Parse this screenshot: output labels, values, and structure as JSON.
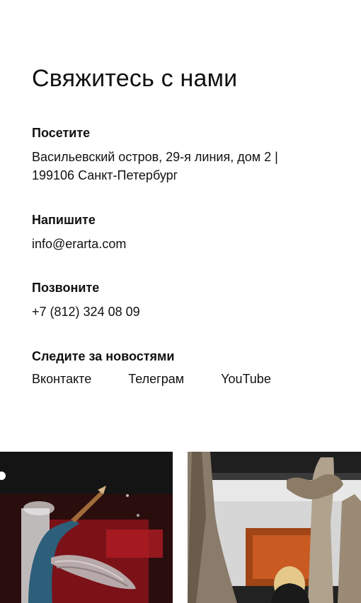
{
  "contact": {
    "title": "Свяжитесь с нами",
    "visit": {
      "heading": "Посетите",
      "address_line1": "Васильевский остров, 29-я линия, дом 2 |",
      "address_line2": "199106 Санкт-Петербург"
    },
    "write": {
      "heading": "Напишите",
      "email": "info@erarta.com"
    },
    "call": {
      "heading": "Позвоните",
      "phone": "+7 (812) 324 08 09"
    },
    "social": {
      "heading": "Следите за новостями",
      "links": [
        "Вконтакте",
        "Телеграм",
        "YouTube"
      ]
    }
  },
  "gallery": {
    "photos": [
      {
        "subject": "sculpture-with-wings-and-trumpet"
      },
      {
        "subject": "visitor-among-tree-trunk-installation"
      }
    ]
  }
}
